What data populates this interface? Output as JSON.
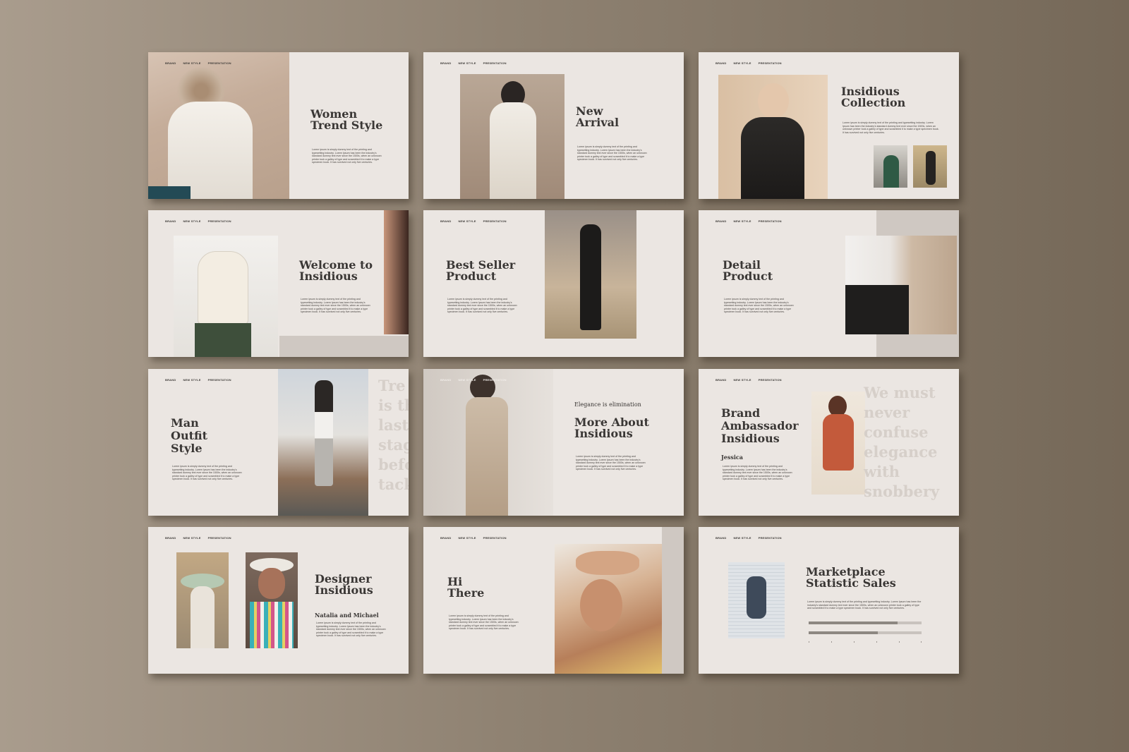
{
  "nav": [
    "BRAND",
    "NEW STYLE",
    "PRESENTATION"
  ],
  "lorem": "Lorem ipsum is simply dummy text of the printing and typesetting industry. Lorem Ipsum has been the industry's standard dummy text ever since the 1500s, when an unknown printer took a galley of type and scrambled it to make a type specimen book. It has survived not only five centuries.",
  "slides": {
    "s1": {
      "title_l1": "Women",
      "title_l2": "Trend Style"
    },
    "s2": {
      "title_l1": "New",
      "title_l2": "Arrival"
    },
    "s3": {
      "title_l1": "Insidious",
      "title_l2": "Collection"
    },
    "s4": {
      "title_l1": "Welcome to",
      "title_l2": "Insidious"
    },
    "s5": {
      "title_l1": "Best Seller",
      "title_l2": "Product"
    },
    "s6": {
      "title_l1": "Detail",
      "title_l2": "Product"
    },
    "s7": {
      "title_l1": "Man",
      "title_l2": "Outfit",
      "title_l3": "Style",
      "quote": "Tre\nis th\nlast\nstag\nbefo\ntack"
    },
    "s8": {
      "eyebrow": "Elegance is elimination",
      "title_l1": "More About",
      "title_l2": "Insidious"
    },
    "s9": {
      "title_l1": "Brand",
      "title_l2": "Ambassador",
      "title_l3": "Insidious",
      "sub": "Jessica",
      "quote": "We must\nnever\nconfuse\nelegance\nwith\nsnobbery"
    },
    "s10": {
      "title_l1": "Designer",
      "title_l2": "Insidious",
      "sub": "Natalia and Michael"
    },
    "s11": {
      "title_l1": "Hi",
      "title_l2": "There"
    },
    "s12": {
      "title_l1": "Marketplace",
      "title_l2": "Statistic Sales"
    }
  },
  "colors": {
    "slide_bg": "#ebe6e2",
    "title": "#3a3735",
    "accent_block": "#cfc8c2"
  },
  "icons": {
    "photos": "photo-placeholder"
  }
}
